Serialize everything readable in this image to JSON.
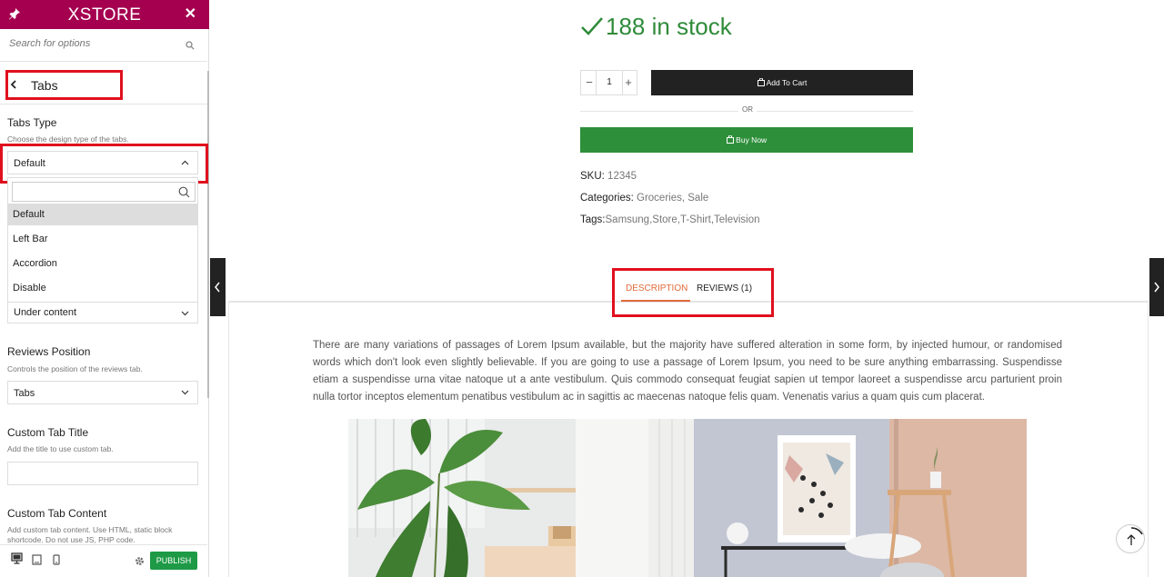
{
  "sidebar": {
    "logo": "XSTORE",
    "search_placeholder": "Search for options",
    "back_title": "Tabs",
    "tabs_type": {
      "label": "Tabs Type",
      "desc": "Choose the design type of the tabs.",
      "value": "Default",
      "options": [
        "Default",
        "Left Bar",
        "Accordion",
        "Disable"
      ]
    },
    "second_select_value": "Under content",
    "reviews_position": {
      "label": "Reviews Position",
      "desc": "Controls the position of the reviews tab.",
      "value": "Tabs"
    },
    "custom_tab_title": {
      "label": "Custom Tab Title",
      "desc": "Add the title to use custom tab."
    },
    "custom_tab_content": {
      "label": "Custom Tab Content",
      "desc": "Add custom tab content. Use HTML, static block shortcode. Do not use JS, PHP code."
    },
    "publish": "PUBLISH"
  },
  "product": {
    "stock": "188 in stock",
    "qty": "1",
    "minus": "−",
    "plus": "+",
    "add_to_cart": "Add To Cart",
    "or": "OR",
    "buy_now": "Buy Now",
    "sku_label": "SKU:",
    "sku": "12345",
    "categories_label": "Categories:",
    "categories": "Groceries, Sale",
    "tags_label": "Tags:",
    "tags": "Samsung,Store,T-Shirt,Television"
  },
  "tabs": {
    "description": "DESCRIPTION",
    "reviews": "REVIEWS (1)"
  },
  "description_text": "There are many variations of passages of Lorem Ipsum available, but the majority have suffered alteration in some form, by injected humour, or randomised words which don't look even slightly believable. If you are going to use a passage of Lorem Ipsum, you need to be sure anything embarrassing. Suspendisse etiam a suspendisse urna vitae natoque ut a ante vestibulum. Quis commodo consequat feugiat sapien ut tempor laoreet a suspendisse arcu parturient proin nulla tortor inceptos elementum penatibus vestibulum ac in sagittis ac maecenas natoque felis quam. Venenatis varius a quam quis cum placerat.",
  "colors": {
    "brand": "#a50050",
    "stock_green": "#2f8b3a",
    "buy_green": "#2e8f3b",
    "highlight_red": "#e0101e",
    "tab_active": "#e06a3a",
    "publish_green": "#1e9a46"
  }
}
